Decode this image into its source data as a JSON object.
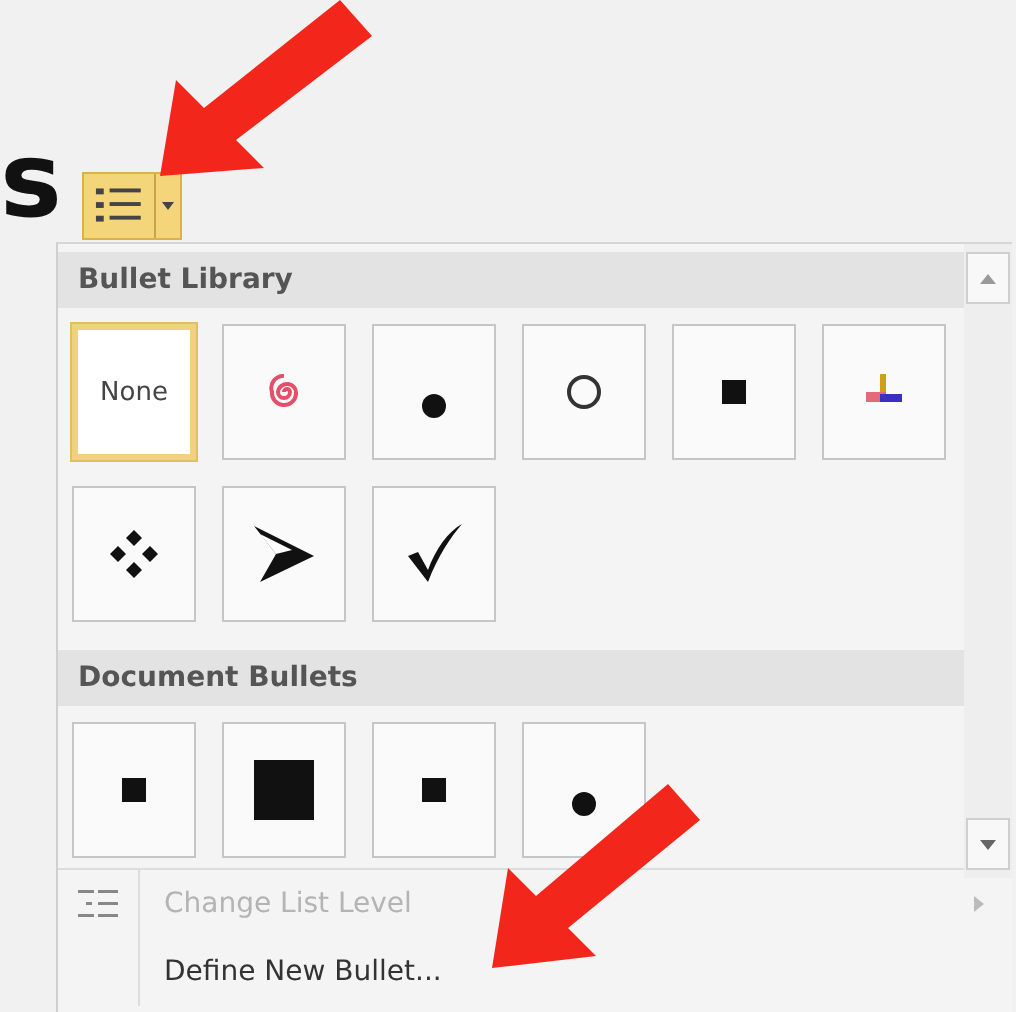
{
  "document_text": "s",
  "bullets_button": {
    "active": true
  },
  "sections": [
    {
      "title": "Bullet Library",
      "items": [
        {
          "kind": "none",
          "label": "None",
          "selected": true
        },
        {
          "kind": "spiral",
          "selected": false
        },
        {
          "kind": "dot",
          "selected": false
        },
        {
          "kind": "circle",
          "selected": false
        },
        {
          "kind": "square",
          "selected": false
        },
        {
          "kind": "colorcross",
          "selected": false
        },
        {
          "kind": "diamonds",
          "selected": false
        },
        {
          "kind": "arrowhead",
          "selected": false
        },
        {
          "kind": "check",
          "selected": false
        }
      ]
    },
    {
      "title": "Document Bullets",
      "items": [
        {
          "kind": "square",
          "selected": false
        },
        {
          "kind": "bigsquare",
          "selected": false
        },
        {
          "kind": "square",
          "selected": false
        },
        {
          "kind": "dot",
          "selected": false
        }
      ]
    }
  ],
  "menu_items": [
    {
      "label": "Change List Level",
      "disabled": true,
      "submenu": true,
      "icon": true
    },
    {
      "label": "Define New Bullet...",
      "disabled": false,
      "submenu": false,
      "icon": false
    }
  ]
}
